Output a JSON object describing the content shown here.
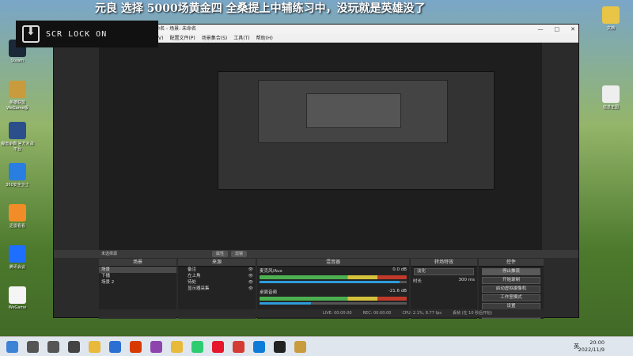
{
  "desktop": {
    "banner": "元良 选择 5000场黄金四 全桑提上中辅练习中，没玩就是英雄没了",
    "left_icons": [
      {
        "label": "Steam",
        "color": "#1b2838"
      },
      {
        "label": "英雄联盟 WeGame版",
        "color": "#c89b3c"
      },
      {
        "label": "魔兽争霸 官方对战平台",
        "color": "#2a4f8a"
      },
      {
        "label": "360安全卫士",
        "color": "#2a7de1"
      },
      {
        "label": "迅雷看看",
        "color": "#f28c28"
      },
      {
        "label": "腾讯会议",
        "color": "#1e6fff"
      },
      {
        "label": "WeGame",
        "color": "#f5f5f5"
      }
    ],
    "right_icons": [
      {
        "label": "文档",
        "color": "#e8c547"
      },
      {
        "label": "信息王国",
        "color": "#eeeeee"
      }
    ]
  },
  "lock_badge": {
    "text": "SCR LOCK ON"
  },
  "obs": {
    "title": "windows) - 配置文件: 未命名 - 场景: 未命名",
    "menu": [
      "V)",
      "配置文件(P)",
      "场景集合(S)",
      "工具(T)",
      "帮助(H)"
    ],
    "window_controls": [
      "—",
      "□",
      "✕"
    ],
    "preview_bar": {
      "label": "未选择源",
      "buttons": [
        "属性",
        "滤镜"
      ]
    },
    "scenes": {
      "header": "场景",
      "items": [
        "场景",
        "下播",
        "场景 2"
      ],
      "selected": 0
    },
    "sources": {
      "header": "来源",
      "items": [
        "备注",
        "左上角",
        "待处",
        "显示器采集"
      ]
    },
    "mixer": {
      "header": "混音器",
      "channels": [
        {
          "name": "麦克风/Aux",
          "db": "0.0 dB",
          "level": 0.95
        },
        {
          "name": "桌面音频",
          "db": "-21.6 dB",
          "level": 0.35
        }
      ]
    },
    "transitions": {
      "header": "转场特效",
      "type": "淡化",
      "duration_label": "时长",
      "duration": "300 ms"
    },
    "controls": {
      "header": "控件",
      "buttons": [
        "停止推流",
        "开始录制",
        "启动虚拟摄像机",
        "工作室模式",
        "设置",
        "退出"
      ]
    },
    "status": {
      "live": "LIVE: 00:00:00",
      "rec": "REC: 00:00:00",
      "cpu": "CPU: 2.1%, 8.77 fps",
      "dropped": "丢帧 (在 10 秒后开始)"
    }
  },
  "taskbar": {
    "icons": [
      {
        "name": "start-icon",
        "color": "#3c82d6"
      },
      {
        "name": "search-icon",
        "color": "#555555"
      },
      {
        "name": "task-view-icon",
        "color": "#555555"
      },
      {
        "name": "pinwheel-icon",
        "color": "#444444"
      },
      {
        "name": "file-explorer-icon",
        "color": "#e8b93a"
      },
      {
        "name": "store-icon",
        "color": "#2a6fd1"
      },
      {
        "name": "office-icon",
        "color": "#d83b01"
      },
      {
        "name": "music-icon",
        "color": "#8e44ad"
      },
      {
        "name": "folder-icon",
        "color": "#e8b93a"
      },
      {
        "name": "app-icon",
        "color": "#2ecc71"
      },
      {
        "name": "weibo-icon",
        "color": "#e6162d"
      },
      {
        "name": "netease-icon",
        "color": "#d43c33"
      },
      {
        "name": "edge-icon",
        "color": "#0f7bd8"
      },
      {
        "name": "obs-icon",
        "color": "#222222"
      },
      {
        "name": "lol-icon",
        "color": "#c89b3c"
      }
    ],
    "language": "英",
    "time": "20:00",
    "date": "2022/11/9"
  }
}
